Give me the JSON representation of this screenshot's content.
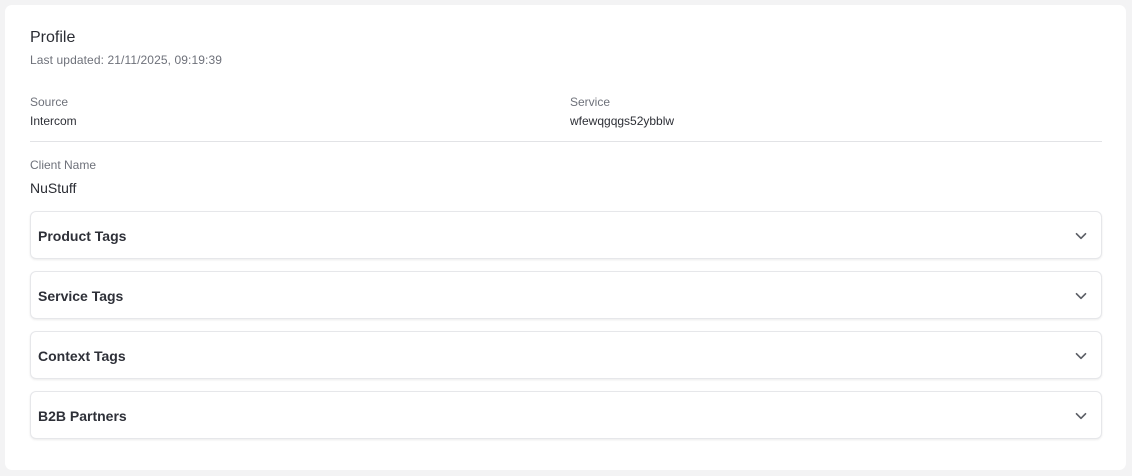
{
  "profile": {
    "title": "Profile",
    "last_updated": "Last updated: 21/11/2025, 09:19:39"
  },
  "fields": {
    "source": {
      "label": "Source",
      "value": "Intercom"
    },
    "service": {
      "label": "Service",
      "value": "wfewqgqgs52ybblw"
    },
    "client_name": {
      "label": "Client Name",
      "value": "NuStuff"
    }
  },
  "sections": [
    {
      "label": "Product Tags",
      "icon": "chevron-down-icon"
    },
    {
      "label": "Service Tags",
      "icon": "chevron-down-icon"
    },
    {
      "label": "Context Tags",
      "icon": "chevron-down-icon"
    },
    {
      "label": "B2B Partners",
      "icon": "chevron-down-icon"
    }
  ]
}
